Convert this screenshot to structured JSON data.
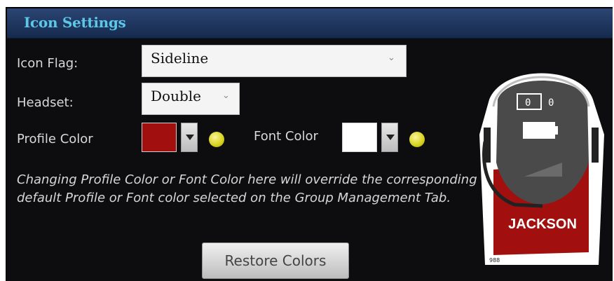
{
  "panel": {
    "title": "Icon Settings"
  },
  "icon_flag": {
    "label": "Icon Flag:",
    "value": "Sideline"
  },
  "headset": {
    "label": "Headset:",
    "value": "Double"
  },
  "profile_color": {
    "label": "Profile Color",
    "color": "#a10f0f"
  },
  "font_color": {
    "label": "Font Color",
    "color": "#ffffff"
  },
  "note": "Changing Profile Color or Font Color here will override the corresponding default Profile or Font color selected on the Group Management Tab.",
  "restore_button": {
    "label": "Restore Colors"
  },
  "preview": {
    "name": "JACKSON",
    "display_left": "0",
    "display_right": "0",
    "corner_text": "988",
    "colors": {
      "profile": "#a10f0f",
      "font": "#ffffff",
      "body": "#4a4a4a",
      "outline": "#ffffff"
    }
  }
}
